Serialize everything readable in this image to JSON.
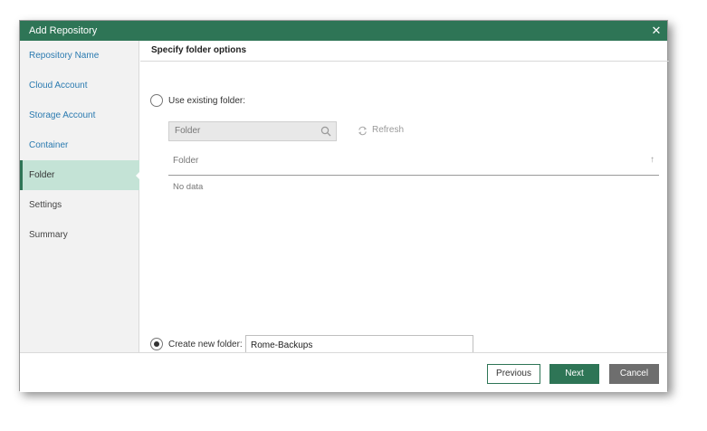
{
  "window": {
    "title": "Add Repository"
  },
  "sidebar": {
    "items": [
      {
        "label": "Repository Name"
      },
      {
        "label": "Cloud Account"
      },
      {
        "label": "Storage Account"
      },
      {
        "label": "Container"
      },
      {
        "label": "Folder"
      },
      {
        "label": "Settings"
      },
      {
        "label": "Summary"
      }
    ]
  },
  "main": {
    "section_title": "Specify folder options",
    "use_existing": {
      "label": "Use existing folder:",
      "selected": false
    },
    "search": {
      "placeholder": "Folder"
    },
    "refresh_label": "Refresh",
    "table": {
      "column": "Folder",
      "sort_indicator": "↑",
      "empty_text": "No data"
    },
    "create_new": {
      "label": "Create new folder:",
      "selected": true,
      "value": "Rome-Backups"
    }
  },
  "footer": {
    "previous_label": "Previous",
    "next_label": "Next",
    "cancel_label": "Cancel"
  },
  "colors": {
    "accent": "#2e7556",
    "active_nav": "#c4e3d6",
    "link": "#2a7ab0"
  }
}
